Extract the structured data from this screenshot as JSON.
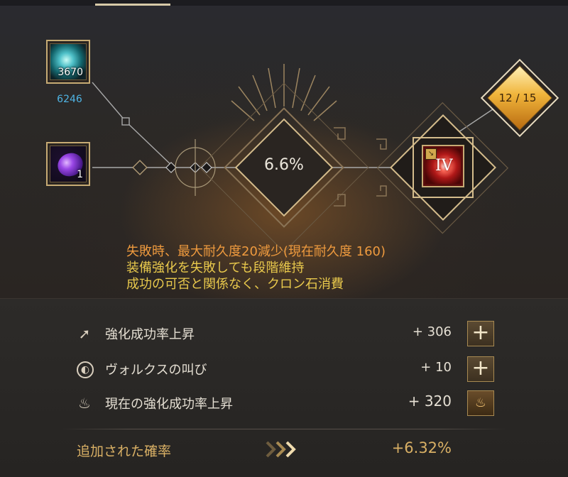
{
  "enhance_panel": {
    "materials": [
      {
        "name": "blue-orb",
        "count": "3670",
        "owned": "6246"
      },
      {
        "name": "purple-gem",
        "count": "1"
      }
    ],
    "success_rate": "6.6%",
    "durability": "12 / 15",
    "item_grade": "IV"
  },
  "notes": [
    "失敗時、最大耐久度20減少(現在耐久度 160)",
    "装備強化を失敗しても段階維持",
    "成功の可否と関係なく、クロン石消費"
  ],
  "stats": [
    {
      "label": "強化成功率上昇",
      "value": "+ 306",
      "button": "+"
    },
    {
      "label": "ヴォルクスの叫び",
      "value": "+ 10",
      "button": "+"
    },
    {
      "label": "現在の強化成功率上昇",
      "value": "+ 320"
    }
  ],
  "added_probability": {
    "label": "追加された確率",
    "value": "+6.32%"
  },
  "colors": {
    "accent_gold": "#c7ab74",
    "warning_orange": "#ee9a3e",
    "info_yellow": "#e9c94c",
    "owned_blue": "#4fb4e4"
  }
}
